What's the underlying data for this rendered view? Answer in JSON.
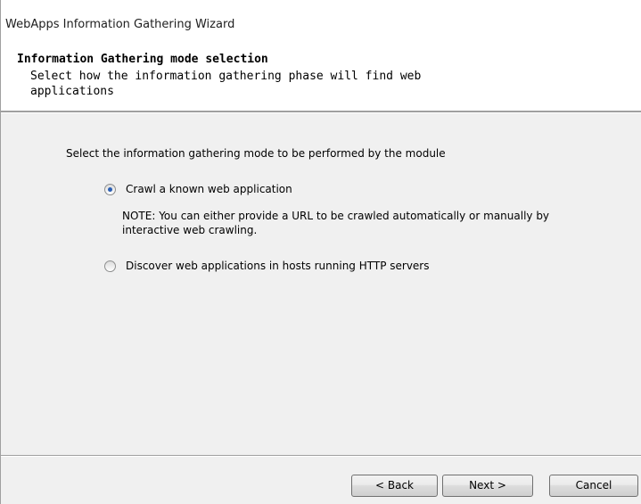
{
  "window": {
    "title": "WebApps Information Gathering Wizard"
  },
  "header": {
    "title": "Information Gathering mode selection",
    "subtitle": "Select how the information gathering phase will find web applications"
  },
  "body": {
    "prompt": "Select the information gathering mode to be performed by the module",
    "options": [
      {
        "label": "Crawl a known web application",
        "selected": true
      },
      {
        "label": "Discover web applications in hosts running HTTP servers",
        "selected": false
      }
    ],
    "note": "NOTE: You can either provide a URL to be crawled automatically or manually by interactive web crawling."
  },
  "buttons": {
    "back": "< Back",
    "next": "Next >",
    "cancel": "Cancel"
  },
  "colors": {
    "radio_selected": "#2c5fb3",
    "window_background": "#f0f0f0",
    "header_background": "#ffffff"
  }
}
